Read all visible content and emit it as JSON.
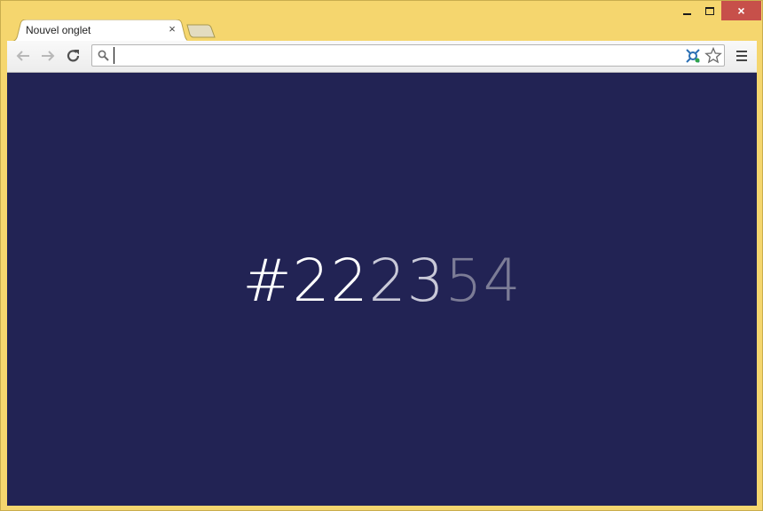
{
  "window": {
    "controls": {
      "minimize": "minimize",
      "maximize": "maximize",
      "close": "×"
    }
  },
  "tabs": [
    {
      "title": "Nouvel onglet",
      "close": "×",
      "active": true
    }
  ],
  "toolbar": {
    "address_value": "",
    "icons": [
      "back-arrow-icon",
      "forward-arrow-icon",
      "reload-icon",
      "search-icon",
      "extension-icon",
      "star-icon",
      "menu-icon"
    ]
  },
  "page": {
    "background": "#222354",
    "hex_parts": [
      {
        "text": "#22",
        "color": "#ffffff"
      },
      {
        "text": "23",
        "color": "#c9c9d8"
      },
      {
        "text": "54",
        "color": "#7c7c96"
      }
    ]
  }
}
